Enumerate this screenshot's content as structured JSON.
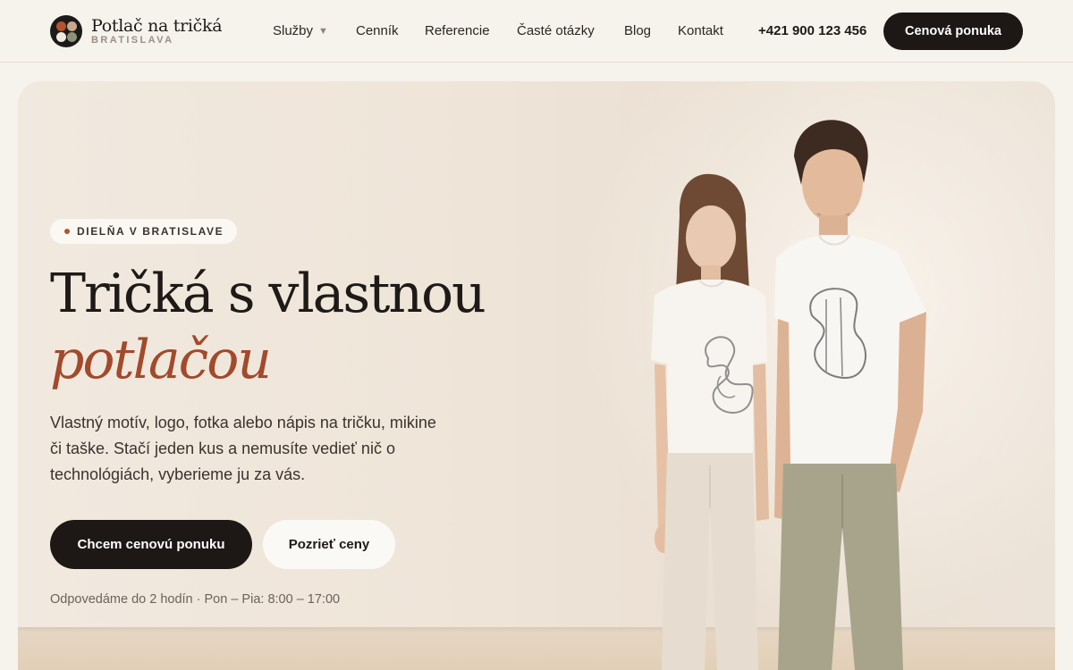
{
  "brand": {
    "title": "Potlač na tričká",
    "subtitle": "BRATISLAVA",
    "icon": "four-dots-logo-icon",
    "colors": {
      "accent": "#a24a2b",
      "dark": "#1d1815"
    }
  },
  "nav": {
    "items": [
      {
        "label": "Služby",
        "has_dropdown": true
      },
      {
        "label": "Cenník"
      },
      {
        "label": "Referencie"
      },
      {
        "label": "Časté otázky"
      },
      {
        "label": "Blog"
      },
      {
        "label": "Kontakt"
      }
    ],
    "dropdown_icon": "▼"
  },
  "header": {
    "phone": "+421 900 123 456",
    "cta_label": "Cenová ponuka"
  },
  "hero": {
    "badge": "DIELŇA V BRATISLAVE",
    "title_line1": "Tričká s vlastnou",
    "title_line2": "potlačou",
    "lead": "Vlastný motív, logo, fotka alebo nápis na tričku, mikine či taške. Stačí jeden kus a nemusíte vedieť nič o technológiách, vyberieme ju za vás.",
    "primary_cta": "Chcem cenovú ponuku",
    "secondary_cta": "Pozrieť ceny",
    "note": "Odpovedáme do 2 hodín · Pon – Pia: 8:00 – 17:00",
    "image_icon": "couple-in-printed-tshirts-photo"
  }
}
